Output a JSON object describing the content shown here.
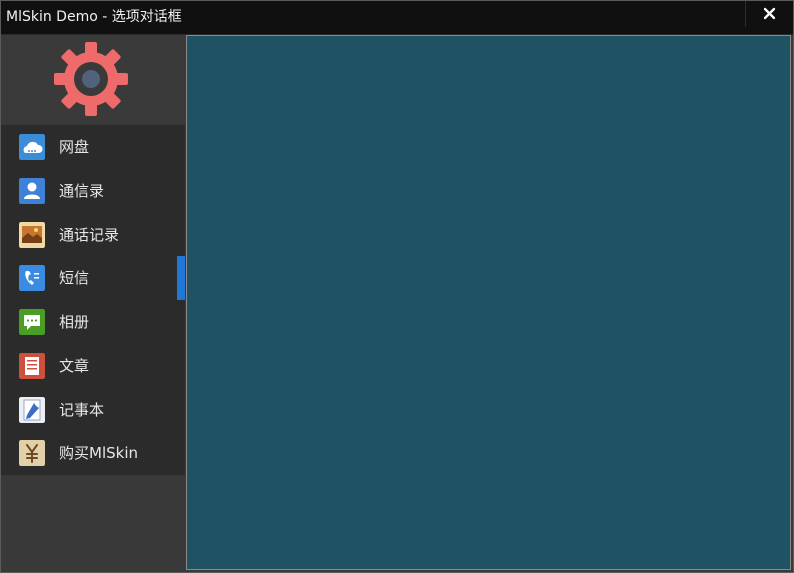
{
  "window": {
    "title": "MlSkin Demo - 选项对话框"
  },
  "sidebar": {
    "items": [
      {
        "label": "网盘",
        "icon": "cloud-icon",
        "active": false
      },
      {
        "label": "通信录",
        "icon": "contact-icon",
        "active": false
      },
      {
        "label": "通话记录",
        "icon": "photo-icon",
        "active": false
      },
      {
        "label": "短信",
        "icon": "phone-book-icon",
        "active": true
      },
      {
        "label": "相册",
        "icon": "message-icon",
        "active": false
      },
      {
        "label": "文章",
        "icon": "article-icon",
        "active": false
      },
      {
        "label": "记事本",
        "icon": "notepad-icon",
        "active": false
      },
      {
        "label": "购买MlSkin",
        "icon": "yuan-icon",
        "active": false
      }
    ]
  },
  "colors": {
    "title_bar": "#101010",
    "sidebar": "#393939",
    "menu": "#2b2b2b",
    "accent": "#1f77d8",
    "content": "#1f5263",
    "logo": "#ef6a6a"
  }
}
